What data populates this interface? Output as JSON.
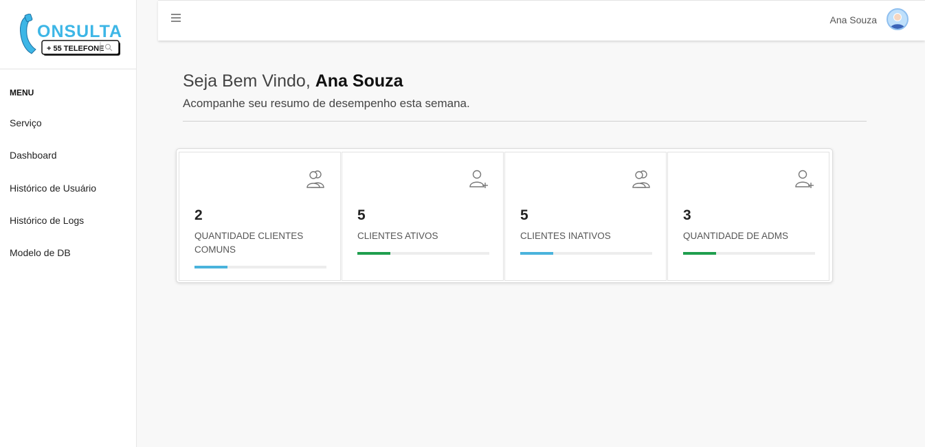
{
  "logo": {
    "word": "ONSULTA",
    "badge": "+ 55 TELEFONE"
  },
  "sidebar": {
    "menu_title": "MENU",
    "items": [
      {
        "label": "Serviço"
      },
      {
        "label": "Dashboard"
      },
      {
        "label": "Histórico de Usuário"
      },
      {
        "label": "Histórico de Logs"
      },
      {
        "label": "Modelo de DB"
      }
    ]
  },
  "header": {
    "menu_icon": "hamburger-icon",
    "user_name": "Ana Souza",
    "avatar_icon": "user-avatar-icon"
  },
  "welcome": {
    "greeting": "Seja Bem Vindo, ",
    "name": "Ana Souza",
    "subtitle": "Acompanhe seu resumo de desempenho esta semana."
  },
  "cards": [
    {
      "value": "2",
      "label": "QUANTIDADE CLIENTES COMUNS",
      "icon": "users-icon",
      "bar_color": "#4ab3dc",
      "progress": 0.25
    },
    {
      "value": "5",
      "label": "CLIENTES ATIVOS",
      "icon": "user-plus-icon",
      "bar_color": "#1f9e4e",
      "progress": 0.25
    },
    {
      "value": "5",
      "label": "CLIENTES INATIVOS",
      "icon": "users-icon",
      "bar_color": "#4ab3dc",
      "progress": 0.25
    },
    {
      "value": "3",
      "label": "QUANTIDADE DE ADMS",
      "icon": "user-plus-icon",
      "bar_color": "#1f9e4e",
      "progress": 0.25
    }
  ]
}
